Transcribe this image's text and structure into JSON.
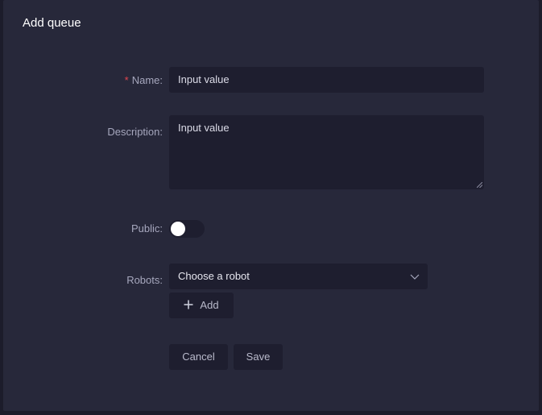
{
  "dialog": {
    "title": "Add queue"
  },
  "form": {
    "name": {
      "required_mark": "*",
      "label": "Name:",
      "value": "Input value"
    },
    "description": {
      "label": "Description:",
      "value": "Input value"
    },
    "public": {
      "label": "Public:",
      "checked": false
    },
    "robots": {
      "label": "Robots:",
      "placeholder": "Choose a robot",
      "add_label": "Add"
    }
  },
  "actions": {
    "cancel_label": "Cancel",
    "save_label": "Save"
  }
}
